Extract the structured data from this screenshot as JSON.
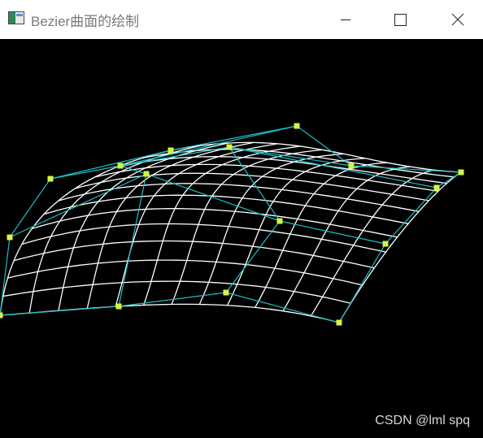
{
  "window": {
    "title": "Bezier曲面的绘制",
    "controls": {
      "minimize_icon": "minimize-icon",
      "maximize_icon": "maximize-icon",
      "close_icon": "close-icon"
    }
  },
  "colors": {
    "canvas_background": "#000000",
    "surface_mesh": "#ffffff",
    "control_net": "#1bbfc6",
    "control_points": "#d6f542",
    "titlebar_background": "#ffffff",
    "title_text": "#7a7a7a"
  },
  "canvas": {
    "watermark": "CSDN @lml spq"
  }
}
